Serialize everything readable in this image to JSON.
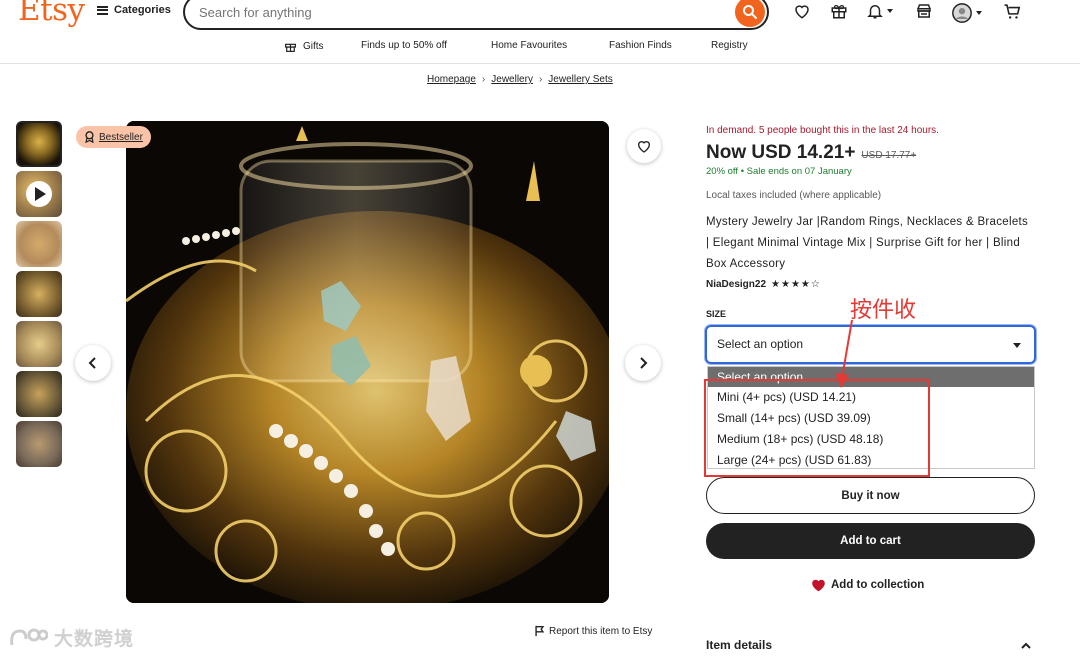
{
  "header": {
    "logo": "Etsy",
    "categories_label": "Categories",
    "search_placeholder": "Search for anything",
    "nav": [
      "Gifts",
      "Finds up to 50% off",
      "Home Favourites",
      "Fashion Finds",
      "Registry"
    ]
  },
  "breadcrumb": [
    "Homepage",
    "Jewellery",
    "Jewellery Sets"
  ],
  "gallery": {
    "badge": "Bestseller",
    "thumbnail_count": 7,
    "report_link": "Report this item to Etsy"
  },
  "product": {
    "demand": "In demand. 5 people bought this in the last 24 hours.",
    "price_now": "Now USD 14.21+",
    "price_old": "USD 17.77+",
    "discount": "20% off",
    "sale_ends": "Sale ends on 07 January",
    "taxes": "Local taxes included (where applicable)",
    "title": "Mystery Jewelry Jar |Random Rings, Necklaces & Bracelets | Elegant Minimal Vintage Mix | Surprise Gift for her | Blind Box Accessory",
    "shop_name": "NiaDesign22",
    "rating_stars": "★★★★☆",
    "size_label": "SIZE",
    "size_selected": "Select an option",
    "size_options": [
      "Select an option",
      "Mini (4+ pcs) (USD 14.21)",
      "Small (14+ pcs) (USD 39.09)",
      "Medium (18+ pcs) (USD 48.18)",
      "Large (24+ pcs) (USD 61.83)"
    ],
    "buy_now": "Buy it now",
    "add_to_cart": "Add to cart",
    "add_to_collection": "Add to collection",
    "item_details": "Item details"
  },
  "annotation": {
    "text": "按件收"
  },
  "watermark": {
    "text": "大数跨境"
  },
  "colors": {
    "brand": "#f1641e",
    "sale_green": "#1d7d2f",
    "demand_red": "#a61a2e",
    "annotation_red": "#e53935",
    "focus_blue": "#2f66d9"
  }
}
